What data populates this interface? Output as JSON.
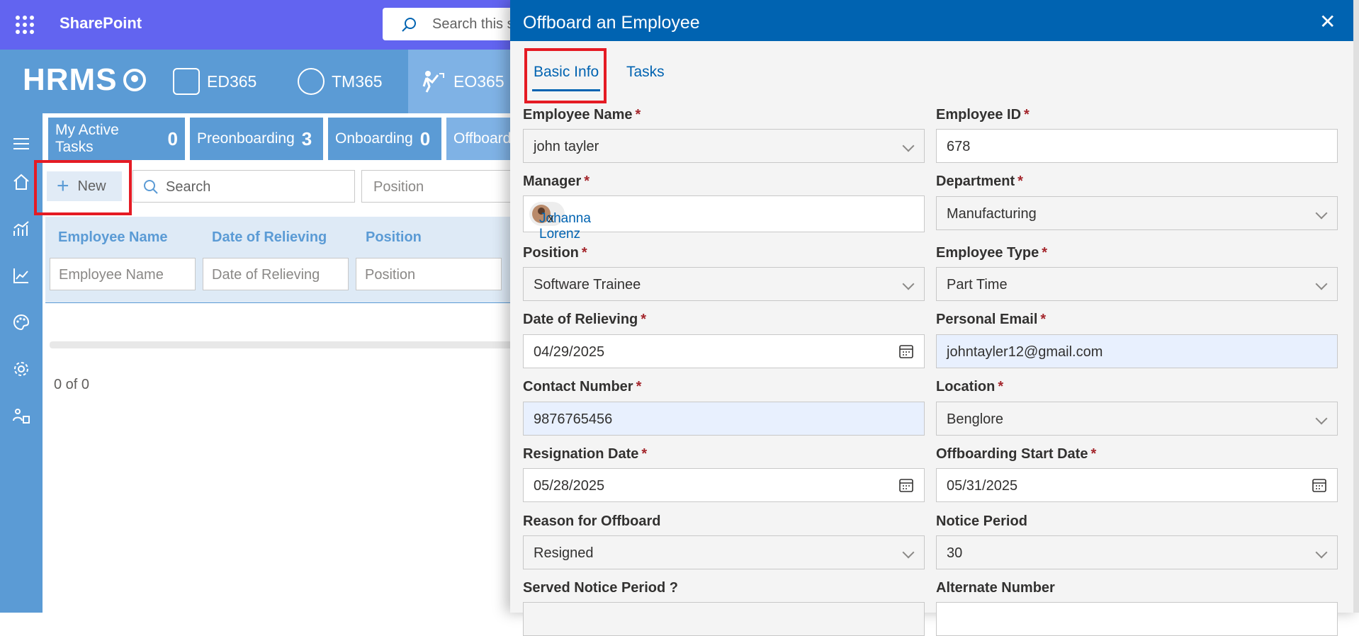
{
  "topbar": {
    "app_name": "SharePoint",
    "search_placeholder": "Search this s"
  },
  "appbar": {
    "logo_text": "HRMS",
    "nav": [
      {
        "label": "ED365"
      },
      {
        "label": "TM365"
      },
      {
        "label": "EO365"
      }
    ]
  },
  "tabs": [
    {
      "label": "My Active Tasks",
      "count": "0"
    },
    {
      "label": "Preonboarding",
      "count": "3"
    },
    {
      "label": "Onboarding",
      "count": "0"
    },
    {
      "label": "Offboard"
    }
  ],
  "toolbar": {
    "new_label": "New",
    "search_placeholder": "Search",
    "position_placeholder": "Position"
  },
  "grid": {
    "columns": [
      "Employee Name",
      "Date of Relieving",
      "Position"
    ],
    "filters": [
      "Employee Name",
      "Date of Relieving",
      "Position"
    ],
    "count_text": "0 of 0"
  },
  "panel": {
    "title": "Offboard an Employee",
    "close_glyph": "✕",
    "tabs": [
      "Basic Info",
      "Tasks"
    ],
    "fields": {
      "employee_name": {
        "label": "Employee Name",
        "value": "john tayler"
      },
      "employee_id": {
        "label": "Employee ID",
        "value": "678"
      },
      "manager": {
        "label": "Manager",
        "value": "Johanna Lorenz",
        "remove": "x"
      },
      "department": {
        "label": "Department",
        "value": "Manufacturing"
      },
      "position": {
        "label": "Position",
        "value": "Software Trainee"
      },
      "employee_type": {
        "label": "Employee Type",
        "value": "Part Time"
      },
      "date_of_relieving": {
        "label": "Date of Relieving",
        "value": "04/29/2025"
      },
      "personal_email": {
        "label": "Personal Email",
        "value": "johntayler12@gmail.com"
      },
      "contact_number": {
        "label": "Contact Number",
        "value": "9876765456"
      },
      "location": {
        "label": "Location",
        "value": "Benglore"
      },
      "resignation_date": {
        "label": "Resignation Date",
        "value": "05/28/2025"
      },
      "offboarding_start_date": {
        "label": "Offboarding Start Date",
        "value": "05/31/2025"
      },
      "reason_for_offboard": {
        "label": "Reason for Offboard",
        "value": "Resigned"
      },
      "notice_period": {
        "label": "Notice Period",
        "value": "30"
      },
      "served_notice_period": {
        "label": "Served Notice Period ?"
      },
      "alternate_number": {
        "label": "Alternate Number"
      }
    },
    "required_mark": "*"
  },
  "colors": {
    "suite_bar": "#6264f0",
    "app_bar": "#5b9bd5",
    "panel_header": "#0063b1",
    "highlight": "#e51b24"
  }
}
